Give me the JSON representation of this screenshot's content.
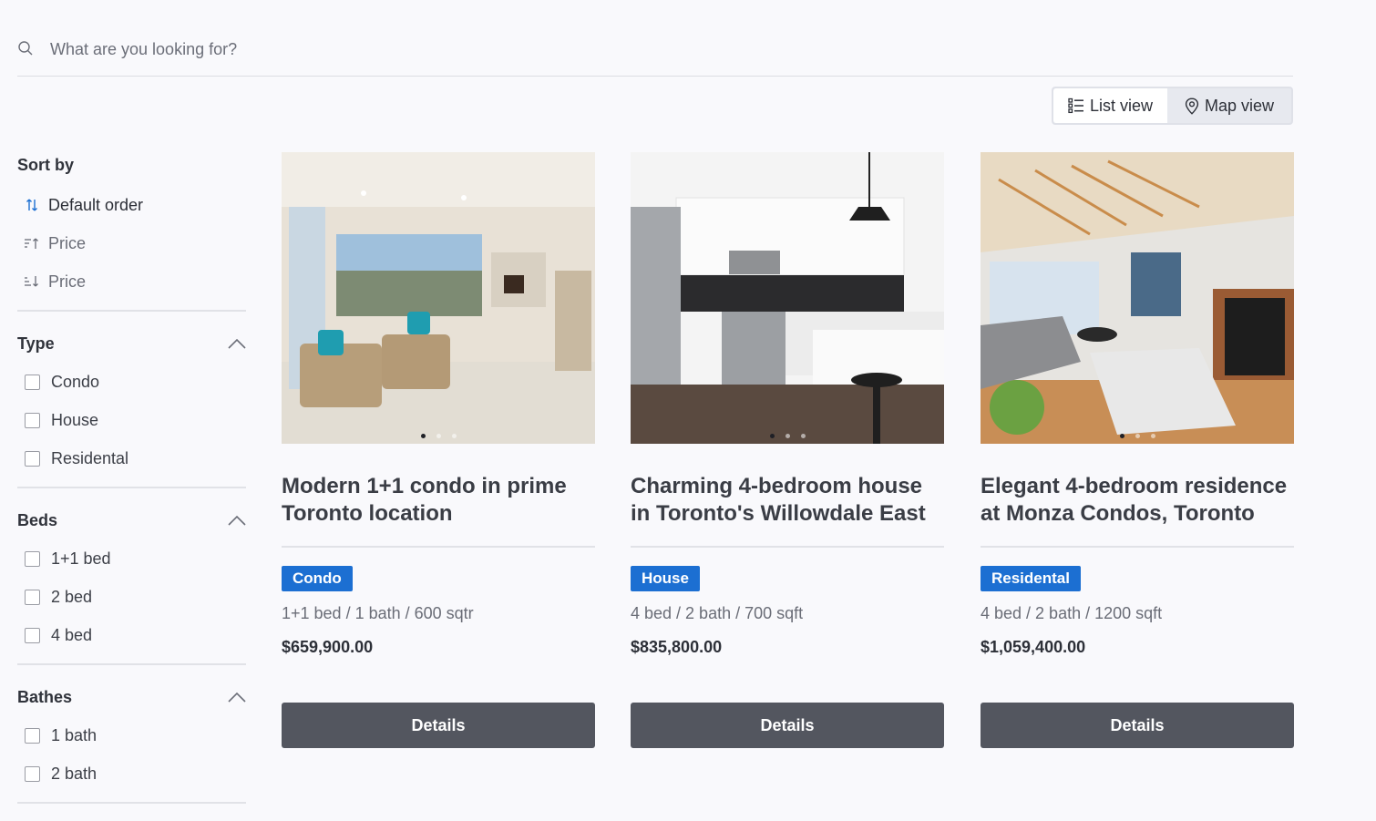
{
  "search": {
    "placeholder": "What are you looking for?",
    "icon": "search-icon"
  },
  "view_toggle": {
    "list_label": "List view",
    "map_label": "Map view",
    "active": "list"
  },
  "sidebar": {
    "sort_title": "Sort by",
    "sort_options": [
      {
        "label": "Default order",
        "icon": "sort-default-icon",
        "active": true
      },
      {
        "label": "Price",
        "icon": "sort-ascending-icon",
        "active": false
      },
      {
        "label": "Price",
        "icon": "sort-descending-icon",
        "active": false
      }
    ],
    "type": {
      "title": "Type",
      "options": [
        "Condo",
        "House",
        "Residental"
      ]
    },
    "beds": {
      "title": "Beds",
      "options": [
        "1+1 bed",
        "2 bed",
        "4 bed"
      ]
    },
    "bathes": {
      "title": "Bathes",
      "options": [
        "1 bath",
        "2 bath"
      ]
    }
  },
  "listings": [
    {
      "title": "Modern 1+1 condo in prime Toronto location",
      "badge": "Condo",
      "specs": "1+1 bed / 1 bath / 600 sqtr",
      "price": "$659,900.00",
      "button": "Details",
      "photo": "living-room-photo"
    },
    {
      "title": "Charming 4-bedroom house in Toronto's Willowdale East",
      "badge": "House",
      "specs": "4 bed / 2 bath / 700 sqft",
      "price": "$835,800.00",
      "button": "Details",
      "photo": "kitchen-photo"
    },
    {
      "title": "Elegant 4-bedroom residence at Monza Condos, Toronto",
      "badge": "Residental",
      "specs": "4 bed / 2 bath / 1200 sqft",
      "price": "$1,059,400.00",
      "button": "Details",
      "photo": "loft-living-room-photo"
    }
  ],
  "colors": {
    "badge": "#1c6fd2",
    "button": "#53565f",
    "background": "#f9f9fc",
    "accent_icon": "#1c6fd2"
  }
}
